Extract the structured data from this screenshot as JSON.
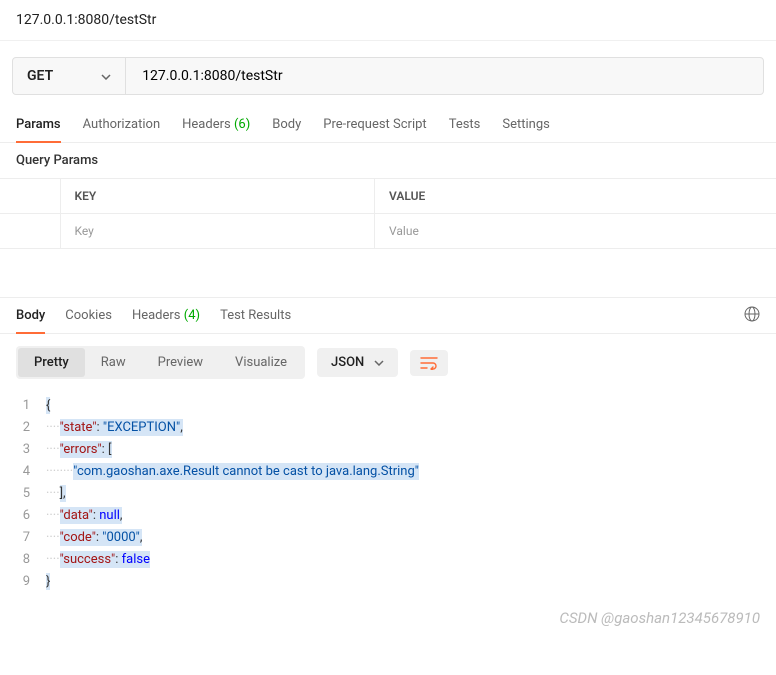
{
  "title": "127.0.0.1:8080/testStr",
  "request": {
    "method": "GET",
    "url": "127.0.0.1:8080/testStr"
  },
  "tabs": {
    "params": "Params",
    "authorization": "Authorization",
    "headers": "Headers",
    "headers_count": "(6)",
    "body": "Body",
    "prerequest": "Pre-request Script",
    "tests": "Tests",
    "settings": "Settings"
  },
  "query_params": {
    "heading": "Query Params",
    "col_key": "KEY",
    "col_value": "VALUE",
    "ph_key": "Key",
    "ph_value": "Value"
  },
  "resp_tabs": {
    "body": "Body",
    "cookies": "Cookies",
    "headers": "Headers",
    "headers_count": "(4)",
    "test_results": "Test Results"
  },
  "views": {
    "pretty": "Pretty",
    "raw": "Raw",
    "preview": "Preview",
    "visualize": "Visualize"
  },
  "body_type": "JSON",
  "response_json": {
    "state": "EXCEPTION",
    "errors": [
      "com.gaoshan.axe.Result cannot be cast to java.lang.String"
    ],
    "data": null,
    "code": "0000",
    "success": false
  },
  "code_lines": [
    {
      "n": 1,
      "raw": "{"
    },
    {
      "n": 2,
      "indent": 1,
      "k": "state",
      "vstr": "EXCEPTION",
      "trail": ","
    },
    {
      "n": 3,
      "indent": 1,
      "k": "errors",
      "after_colon": "["
    },
    {
      "n": 4,
      "indent": 2,
      "vstr_only": "com.gaoshan.axe.Result cannot be cast to java.lang.String"
    },
    {
      "n": 5,
      "indent": 1,
      "raw": "],"
    },
    {
      "n": 6,
      "indent": 1,
      "k": "data",
      "vkw": "null",
      "trail": ","
    },
    {
      "n": 7,
      "indent": 1,
      "k": "code",
      "vstr": "0000",
      "trail": ","
    },
    {
      "n": 8,
      "indent": 1,
      "k": "success",
      "vkw": "false"
    },
    {
      "n": 9,
      "raw": "}"
    }
  ],
  "watermark": "CSDN @gaoshan12345678910"
}
